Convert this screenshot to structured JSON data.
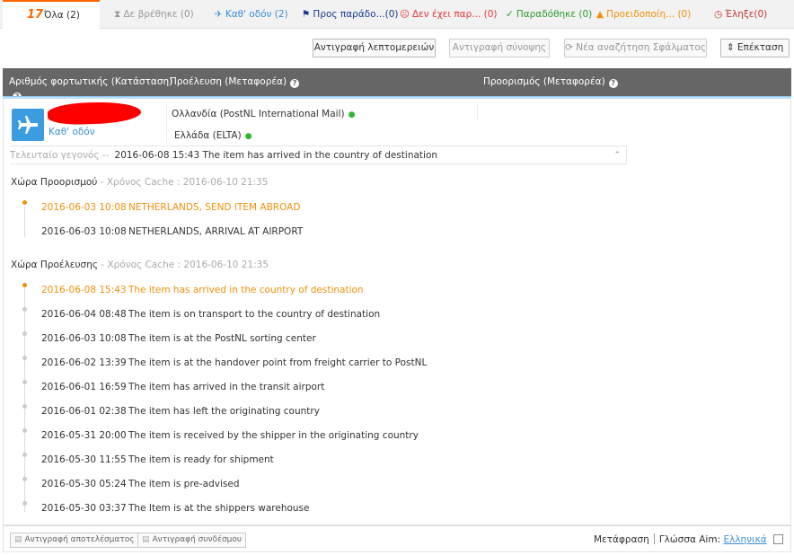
{
  "tabs": [
    {
      "label": "Όλα",
      "count": "(2)",
      "icon": "17-logo"
    },
    {
      "label": "Δε βρέθηκε",
      "count": "(0)",
      "icon": "hourglass-icon"
    },
    {
      "label": "Καθ' οδόν",
      "count": "(2)",
      "icon": "plane-icon"
    },
    {
      "label": "Προς παράδο...",
      "count": "(0)",
      "icon": "flag-icon"
    },
    {
      "label": "Δεν έχει παρ...",
      "count": "(0)",
      "icon": "sad-face-icon"
    },
    {
      "label": "Παραδόθηκε",
      "count": "(0)",
      "icon": "check-icon"
    },
    {
      "label": "Προειδοποίη...",
      "count": "(0)",
      "icon": "warning-icon"
    },
    {
      "label": "Έληξε",
      "count": "(0)",
      "icon": "expired-clock-icon"
    }
  ],
  "logo": "17",
  "toolbar": {
    "copy_details": "Αντιγραφή λεπτομερειών",
    "copy_summary": "Αντιγραφή σύνοψης",
    "new_search": "Νέα αναζήτηση Σφάλματος",
    "expand": "Επέκταση"
  },
  "header": {
    "tracking": "Αριθμός φορτωτικής (Κατάσταση)",
    "origin": "Προέλευση (Μεταφορέα)",
    "destination": "Προορισμός (Μεταφορέα)"
  },
  "shipment": {
    "status": "Καθ' οδόν",
    "origin": "Ολλανδία  (PostNL International Mail)",
    "destination": "Ελλάδα  (ELTA)",
    "last_event_label": "Τελευταίο γεγονός --",
    "last_event": "2016-06-08 15:43  The item has arrived in the country of destination"
  },
  "destination_section": {
    "title": "Χώρα Προορισμού",
    "cache": " - Χρόνος Cache : 2016-06-10 21:35",
    "events": [
      {
        "date": "2016-06-03 10:08",
        "text": "NETHERLANDS, SEND ITEM ABROAD"
      },
      {
        "date": "2016-06-03 10:08",
        "text": "NETHERLANDS, ARRIVAL AT AIRPORT"
      }
    ]
  },
  "origin_section": {
    "title": "Χώρα Προέλευσης",
    "cache": " - Χρόνος Cache : 2016-06-10 21:35",
    "events": [
      {
        "date": "2016-06-08 15:43",
        "text": "The item has arrived in the country of destination"
      },
      {
        "date": "2016-06-04 08:48",
        "text": "The item is on transport to the country of destination"
      },
      {
        "date": "2016-06-03 10:08",
        "text": "The item is at the PostNL sorting center"
      },
      {
        "date": "2016-06-02 13:39",
        "text": "The item is at the handover point from freight carrier to PostNL"
      },
      {
        "date": "2016-06-01 16:59",
        "text": "The item has arrived in the transit airport"
      },
      {
        "date": "2016-06-01 02:38",
        "text": "The item has left the originating country"
      },
      {
        "date": "2016-05-31 20:00",
        "text": "The item is received by the shipper in the originating country"
      },
      {
        "date": "2016-05-30 11:55",
        "text": "The item is ready for shipment"
      },
      {
        "date": "2016-05-30 05:24",
        "text": "The item is pre-advised"
      },
      {
        "date": "2016-05-30 03:37",
        "text": "The Item is at the shippers warehouse"
      }
    ]
  },
  "footer": {
    "copy_results": "Αντιγραφή αποτελέσματος",
    "copy_link": "Αντιγραφή συνδέσμου",
    "translate": "Μετάφραση",
    "target_lang_label": "Γλώσσα Aim:",
    "target_lang": "Ελληνικά"
  },
  "colors": {
    "accent": "#ff6600",
    "header_bg": "#666666",
    "status_blue": "#3b9ce0",
    "first_event": "#f0900b"
  }
}
